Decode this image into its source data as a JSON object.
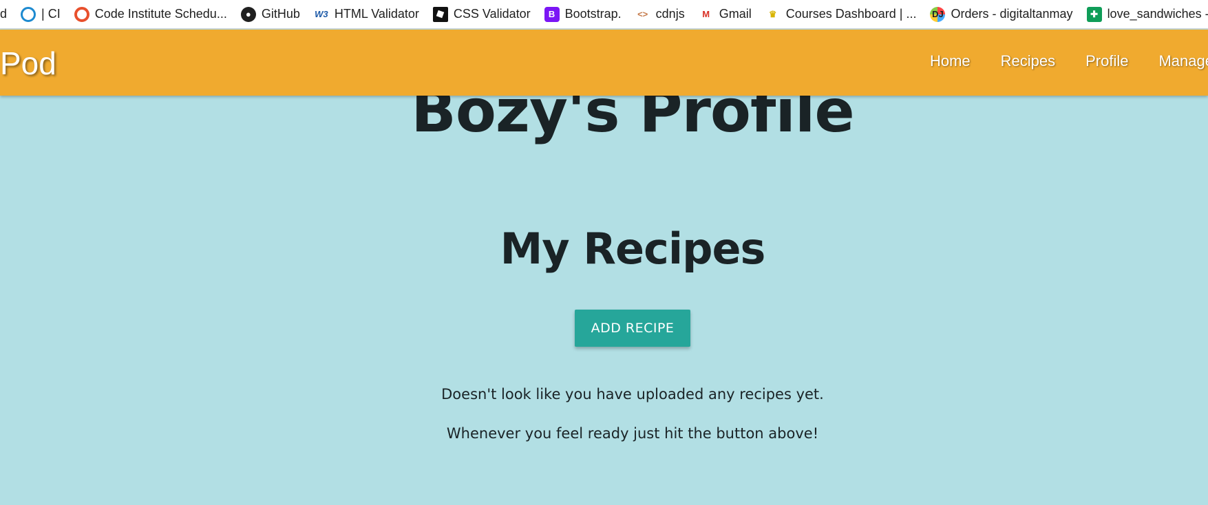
{
  "bookmarks": [
    {
      "label": "d",
      "icon": "none"
    },
    {
      "label": "| CI",
      "icon": "circle-o-icon"
    },
    {
      "label": "Code Institute Schedu...",
      "icon": "orange-ring-icon"
    },
    {
      "label": "GitHub",
      "icon": "github-icon"
    },
    {
      "label": "HTML Validator",
      "icon": "w3c-icon"
    },
    {
      "label": "CSS Validator",
      "icon": "css-validator-icon"
    },
    {
      "label": "Bootstrap.",
      "icon": "bootstrap-icon"
    },
    {
      "label": "cdnjs",
      "icon": "code-brackets-icon"
    },
    {
      "label": "Gmail",
      "icon": "gmail-icon"
    },
    {
      "label": "Courses Dashboard | ...",
      "icon": "crown-icon"
    },
    {
      "label": "Orders - digitaltanmay",
      "icon": "dj-icon"
    },
    {
      "label": "love_sandwiches - Go",
      "icon": "sheets-icon"
    }
  ],
  "navbar": {
    "brand": "Pod",
    "links": [
      "Home",
      "Recipes",
      "Profile",
      "Manage"
    ],
    "color": "#f0aa2f"
  },
  "main": {
    "profile_title": "Bozy's Profile",
    "section_title": "My Recipes",
    "add_button": "ADD RECIPE",
    "message_1": "Doesn't look like you have uploaded any recipes yet.",
    "message_2": "Whenever you feel ready just hit the button above!",
    "background": "#b2dfe4",
    "button_color": "#26a69a"
  }
}
